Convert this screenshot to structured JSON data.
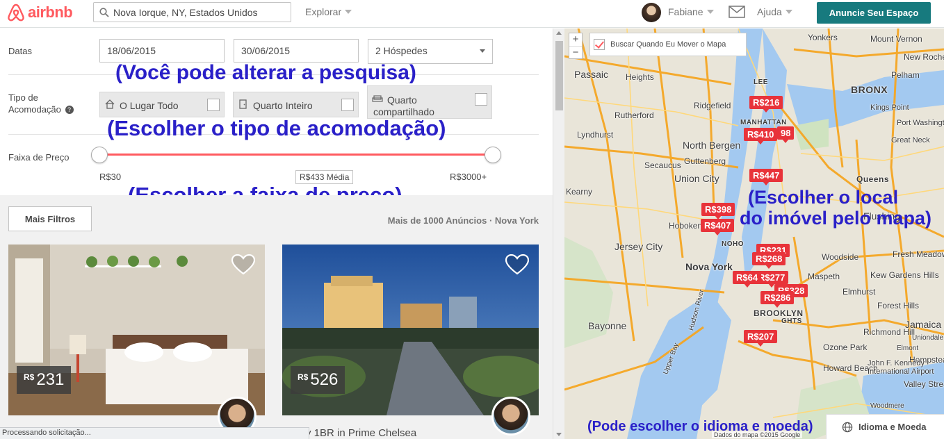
{
  "header": {
    "logo_text": "airbnb",
    "search_value": "Nova Iorque, NY, Estados Unidos",
    "explore_label": "Explorar",
    "user_name": "Fabiane",
    "help_label": "Ajuda",
    "cta_label": "Anuncie Seu Espaço",
    "brand_color": "#ff5a5f",
    "cta_color": "#177a7e"
  },
  "filters": {
    "dates_label": "Datas",
    "checkin": "18/06/2015",
    "checkout": "30/06/2015",
    "guests": "2 Hóspedes",
    "room_type_label_line1": "Tipo de",
    "room_type_label_line2": "Acomodação",
    "room_types": [
      "O Lugar Todo",
      "Quarto Inteiro",
      "Quarto compartilhado"
    ],
    "price_label": "Faixa de Preço",
    "price_min": "R$30",
    "price_avg": "R$433 Média",
    "price_max": "R$3000+"
  },
  "annotations": {
    "search": "(Você pode alterar a pesquisa)",
    "room_type": "(Escolher o tipo de acomodação)",
    "price": "(Escolher a faixa de preço)",
    "map_line1": "(Escolher o local",
    "map_line2": "do imóvel pelo mapa)",
    "language": "(Pode escolher o idioma e moeda)",
    "color": "#2a20c8"
  },
  "listings": {
    "more_filters_label": "Mais Filtros",
    "count_text": "Mais de 1000 Anúncios · Nova York",
    "items": [
      {
        "currency": "R$",
        "price": "231",
        "title": ""
      },
      {
        "currency": "R$",
        "price": "526",
        "title": "y 1BR in Prime Chelsea"
      }
    ]
  },
  "status_bar": "Processando solicitação...",
  "map": {
    "move_search_label": "Buscar Quando Eu Mover o Mapa",
    "move_search_checked": true,
    "zoom_in": "+",
    "zoom_out": "−",
    "places": [
      "Passaic",
      "Heights",
      "Rutherford",
      "Ridgefield",
      "Lyndhurst",
      "North Bergen",
      "Guttenberg",
      "Secaucus",
      "Union City",
      "Hoboken",
      "Jersey City",
      "Nova York",
      "Bayonne",
      "BROOKLYN",
      "BRONX",
      "MANHATTAN",
      "NOHO",
      "Kearny",
      "LEE",
      "GHTS",
      "Queens",
      "Maspeth",
      "Woodside",
      "Elmhurst",
      "Forest Hills",
      "Richmond Hill",
      "Jamaica",
      "Ozone Park",
      "Kew Gardens Hills",
      "Fresh Meadows",
      "Flushing",
      "Mount Vernon",
      "New Rochelle",
      "Pelham",
      "Yonkers",
      "Hempstead",
      "Valley Stream",
      "Howard Beach",
      "Elmont",
      "Uniondale",
      "Woodmere",
      "John F. Kennedy International Airport",
      "Upper Bay",
      "Hudson River",
      "Kings Point",
      "Port Washington",
      "Great Neck"
    ],
    "pins": [
      "R$216",
      "R$410",
      "98",
      "R$447",
      "R$398",
      "R$407",
      "R$231",
      "R$268",
      "R$277",
      "R$64",
      "R$328",
      "R$286",
      "R$207"
    ],
    "language_button": "Idioma e Moeda",
    "credit": "Dados do mapa ©2015 Google"
  }
}
